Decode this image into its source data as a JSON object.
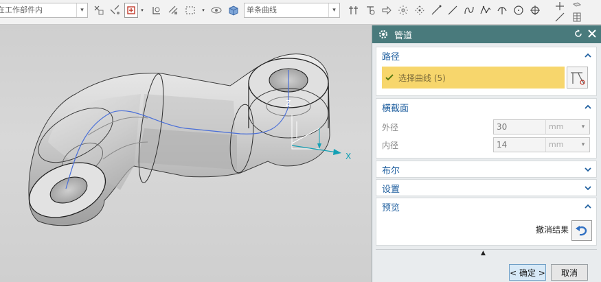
{
  "toolbar": {
    "filter_combo": "在工作部件内",
    "curve_rule_combo": "单条曲线",
    "dropdown_glyph": "▾"
  },
  "viewport": {
    "triad_labels": {
      "x": "X",
      "z": "Z"
    }
  },
  "dialog": {
    "title": "管道",
    "sections": {
      "path": {
        "label": "路径",
        "select_curve": "选择曲线 (5)"
      },
      "cross_section": {
        "label": "横截面",
        "outer": {
          "label": "外径",
          "value": "30",
          "unit": "mm"
        },
        "inner": {
          "label": "内径",
          "value": "14",
          "unit": "mm"
        }
      },
      "boolean": {
        "label": "布尔"
      },
      "settings": {
        "label": "设置"
      },
      "preview": {
        "label": "预览",
        "undo_label": "撤消结果"
      }
    },
    "buttons": {
      "ok": "< 确定 >",
      "cancel": "取消"
    },
    "expand_glyph": "▲"
  },
  "colors": {
    "title_bar": "#497a7c",
    "section_header": "#1f5f9f",
    "selection_highlight": "#f7d66c",
    "axis_x": "#14a0b4",
    "curve_path": "#4a6fd8"
  },
  "icons": [
    "gear-icon",
    "reset-icon",
    "close-icon",
    "chevron-up-icon",
    "chevron-down-icon",
    "check-icon",
    "curve-select-icon",
    "undo-icon"
  ]
}
